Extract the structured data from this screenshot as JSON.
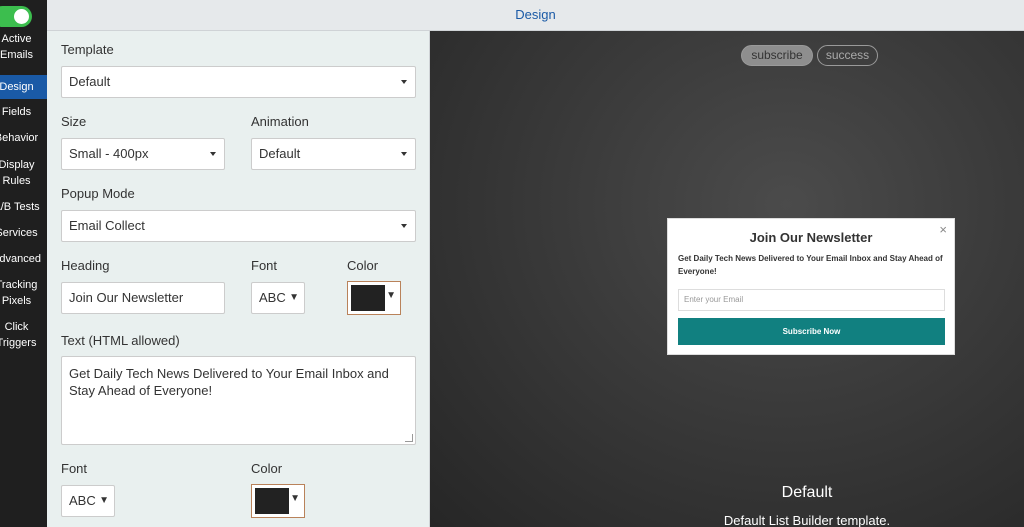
{
  "sidebar": {
    "items": [
      {
        "label": "Active Emails"
      },
      {
        "label": "Design"
      },
      {
        "label": "Fields"
      },
      {
        "label": "Behavior"
      },
      {
        "label": "Display Rules"
      },
      {
        "label": "A/B Tests"
      },
      {
        "label": "Services"
      },
      {
        "label": "Advanced"
      },
      {
        "label": "Tracking Pixels"
      },
      {
        "label": "Click Triggers"
      }
    ]
  },
  "header": {
    "title": "Design"
  },
  "settings": {
    "template": {
      "label": "Template",
      "value": "Default"
    },
    "size": {
      "label": "Size",
      "value": "Small - 400px"
    },
    "animation": {
      "label": "Animation",
      "value": "Default"
    },
    "popup_mode": {
      "label": "Popup Mode",
      "value": "Email Collect"
    },
    "heading": {
      "label": "Heading",
      "value": "Join Our Newsletter"
    },
    "heading_font": {
      "label": "Font",
      "value": "ABC"
    },
    "heading_color": {
      "label": "Color",
      "value": "#222222"
    },
    "text": {
      "label": "Text (HTML allowed)",
      "value": "Get Daily Tech News Delivered to Your Email Inbox and Stay Ahead of Everyone!"
    },
    "text_font": {
      "label": "Font",
      "value": "ABC"
    },
    "text_color": {
      "label": "Color",
      "value": "#222222"
    }
  },
  "preview": {
    "tabs": [
      {
        "label": "subscribe",
        "active": true
      },
      {
        "label": "success",
        "active": false
      }
    ],
    "popup": {
      "close": "×",
      "heading": "Join Our Newsletter",
      "text": "Get Daily Tech News Delivered to Your Email Inbox and Stay Ahead of Everyone!",
      "email_placeholder": "Enter your Email",
      "button": "Subscribe Now"
    },
    "template_name": "Default",
    "template_desc": "Default List Builder template."
  },
  "colors": {
    "accent": "#1a5aa6",
    "toggle_on": "#3cbe4e",
    "button": "#118080"
  }
}
